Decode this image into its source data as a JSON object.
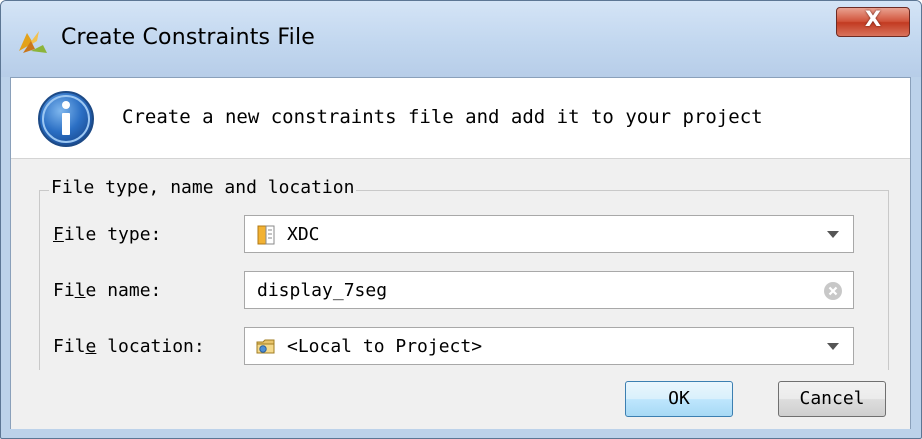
{
  "window": {
    "title": "Create Constraints File",
    "close_label": "X"
  },
  "header": {
    "icon": "info-icon",
    "description": "Create a new constraints file and add it to your project"
  },
  "group": {
    "title": "File type, name and location"
  },
  "fields": {
    "file_type": {
      "label_mnemonic": "F",
      "label_rest": "ile type:",
      "value": "XDC",
      "icon": "xdc-file-icon"
    },
    "file_name": {
      "label_pre": "Fi",
      "label_mnemonic": "l",
      "label_rest": "e name:",
      "value": "display_7seg"
    },
    "file_location": {
      "label_pre": "Fil",
      "label_mnemonic": "e",
      "label_rest": " location:",
      "value": "<Local to Project>",
      "icon": "folder-icon"
    }
  },
  "buttons": {
    "ok": "OK",
    "cancel": "Cancel"
  }
}
